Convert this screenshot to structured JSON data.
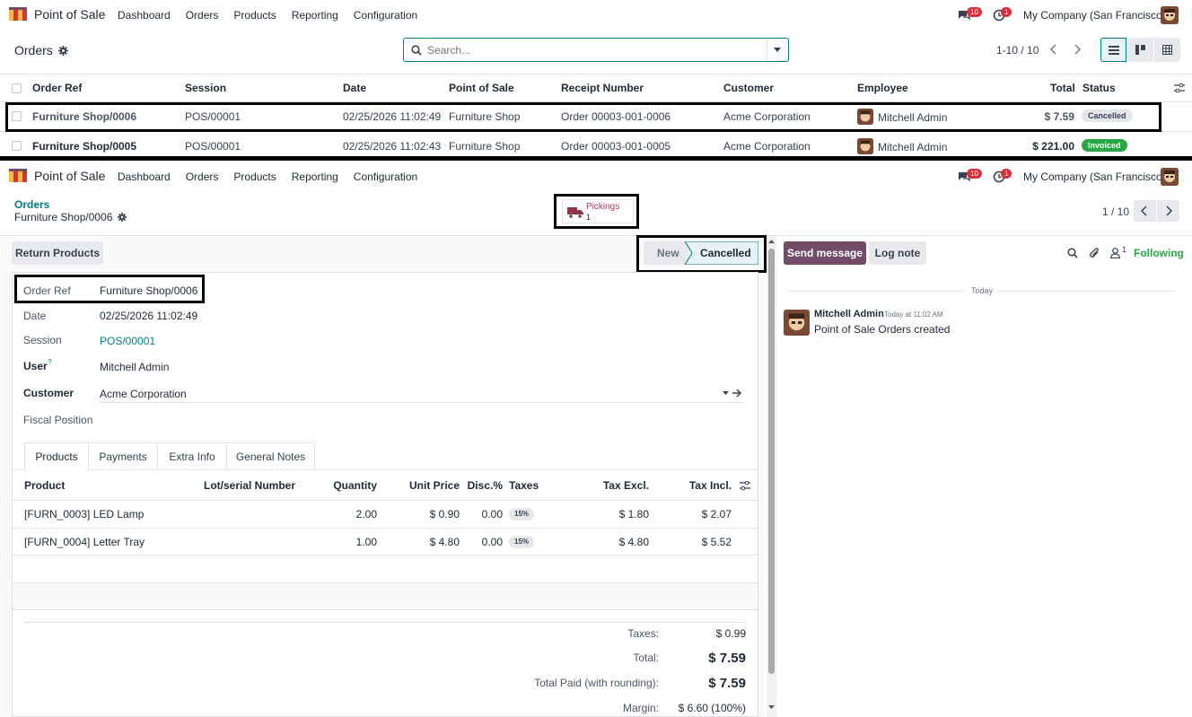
{
  "topnav": {
    "app_name": "Point of Sale",
    "menu": [
      "Dashboard",
      "Orders",
      "Products",
      "Reporting",
      "Configuration"
    ],
    "messages_badge": "10",
    "activities_badge": "1",
    "company": "My Company (San Francisco)"
  },
  "list_view": {
    "title": "Orders",
    "search_placeholder": "Search...",
    "pager": "1-10 / 10",
    "columns": [
      "Order Ref",
      "Session",
      "Date",
      "Point of Sale",
      "Receipt Number",
      "Customer",
      "Employee",
      "Total",
      "Status"
    ],
    "rows": [
      {
        "order_ref": "Furniture Shop/0006",
        "session": "POS/00001",
        "date": "02/25/2026 11:02:49",
        "pos": "Furniture Shop",
        "receipt": "Order 00003-001-0006",
        "customer": "Acme Corporation",
        "employee": "Mitchell Admin",
        "total": "$ 7.59",
        "status": "Cancelled"
      },
      {
        "order_ref": "Furniture Shop/0005",
        "session": "POS/00001",
        "date": "02/25/2026 11:02:43",
        "pos": "Furniture Shop",
        "receipt": "Order 00003-001-0005",
        "customer": "Acme Corporation",
        "employee": "Mitchell Admin",
        "total": "$ 221.00",
        "status": "Invoiced"
      }
    ]
  },
  "form_view": {
    "breadcrumb_parent": "Orders",
    "breadcrumb_current": "Furniture Shop/0006",
    "pickings_label": "Pickings",
    "pickings_count": "1",
    "pager": "1 / 10",
    "return_button": "Return Products",
    "status_steps": [
      "New",
      "Cancelled"
    ],
    "fields": {
      "order_ref_label": "Order Ref",
      "order_ref": "Furniture Shop/0006",
      "date_label": "Date",
      "date": "02/25/2026 11:02:49",
      "session_label": "Session",
      "session": "POS/00001",
      "user_label": "User",
      "user_help": "?",
      "user": "Mitchell Admin",
      "customer_label": "Customer",
      "customer": "Acme Corporation",
      "fiscal_label": "Fiscal Position"
    },
    "tabs": [
      "Products",
      "Payments",
      "Extra Info",
      "General Notes"
    ],
    "lines_columns": [
      "Product",
      "Lot/serial Number",
      "Quantity",
      "Unit Price",
      "Disc.%",
      "Taxes",
      "Tax Excl.",
      "Tax Incl."
    ],
    "lines": [
      {
        "product": "[FURN_0003] LED Lamp",
        "qty": "2.00",
        "price": "$ 0.90",
        "disc": "0.00",
        "tax": "15%",
        "excl": "$ 1.80",
        "incl": "$ 2.07"
      },
      {
        "product": "[FURN_0004] Letter Tray",
        "qty": "1.00",
        "price": "$ 4.80",
        "disc": "0.00",
        "tax": "15%",
        "excl": "$ 4.80",
        "incl": "$ 5.52"
      }
    ],
    "totals": {
      "taxes_label": "Taxes:",
      "taxes": "$ 0.99",
      "total_label": "Total:",
      "total": "$ 7.59",
      "paid_label": "Total Paid (with rounding):",
      "paid": "$ 7.59",
      "margin_label": "Margin:",
      "margin": "$ 6.60 (100%)"
    }
  },
  "chatter": {
    "send_message": "Send message",
    "log_note": "Log note",
    "attachments_count": "1",
    "following": "Following",
    "date_separator": "Today",
    "author": "Mitchell Admin",
    "time": "Today at 11:02 AM",
    "body": "Point of Sale Orders created"
  },
  "colors": {
    "accent": "#714b67",
    "teal": "#017e84",
    "cancelled_pill": "#e5e7eb",
    "invoiced_pill": "#28a745",
    "badge": "#d9303c"
  }
}
